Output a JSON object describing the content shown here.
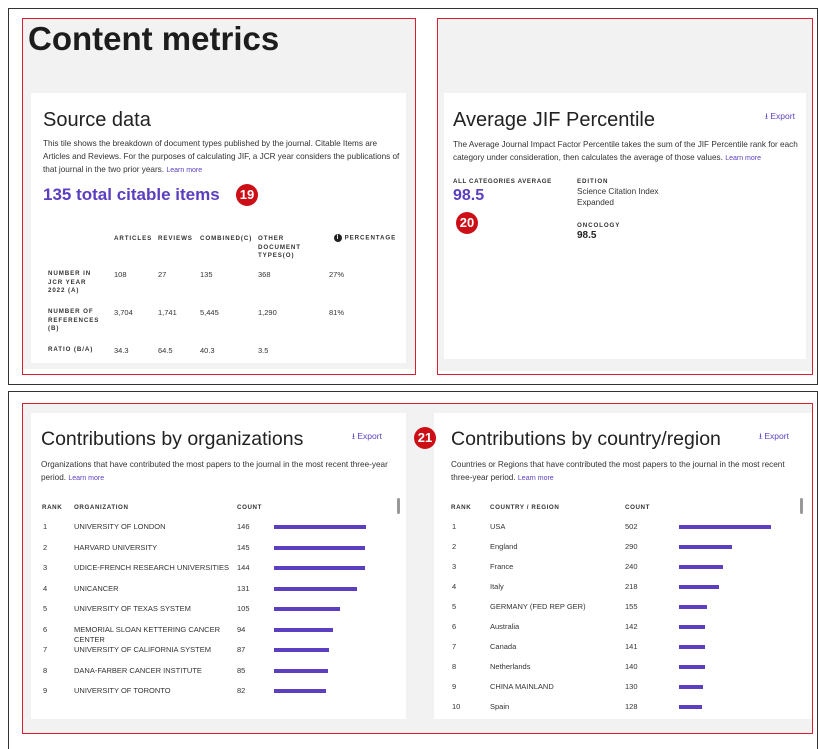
{
  "content_metrics": {
    "title": "Content metrics"
  },
  "source_data": {
    "title": "Source data",
    "description": "This tile shows the breakdown of document types published by the journal. Citable Items are Articles and Reviews. For the purposes of calculating JIF, a JCR year considers the publications of that journal in the two prior years.",
    "learn_more": "Learn more",
    "total": "135 total citable items",
    "headers": [
      "ARTICLES",
      "REVIEWS",
      "COMBINED(C)",
      "OTHER DOCUMENT TYPES(O)",
      "PERCENTAGE"
    ],
    "rows": [
      {
        "label": "NUMBER IN JCR YEAR 2022 (A)",
        "values": [
          "108",
          "27",
          "135",
          "368",
          "27%"
        ]
      },
      {
        "label": "NUMBER OF REFERENCES (B)",
        "values": [
          "3,704",
          "1,741",
          "5,445",
          "1,290",
          "81%"
        ]
      },
      {
        "label": "RATIO (B/A)",
        "values": [
          "34.3",
          "64.5",
          "40.3",
          "3.5",
          ""
        ]
      }
    ]
  },
  "jif": {
    "title": "Average JIF Percentile",
    "export": "Export",
    "description": "The Average Journal Impact Factor Percentile takes the sum of the JIF Percentile rank for each category under consideration, then calculates the average of those values.",
    "learn_more": "Learn more",
    "avg_label": "ALL CATEGORIES AVERAGE",
    "avg_value": "98.5",
    "edition_label": "EDITION",
    "edition_value": "Science Citation Index Expanded",
    "oncology_label": "ONCOLOGY",
    "oncology_value": "98.5"
  },
  "badges": {
    "b19": "19",
    "b20": "20",
    "b21": "21"
  },
  "orgs": {
    "title": "Contributions by organizations",
    "export": "Export",
    "description": "Organizations that have contributed the most papers to the journal in the most recent three-year period.",
    "learn_more": "Learn more",
    "col_rank": "RANK",
    "col_name": "ORGANIZATION",
    "col_count": "COUNT",
    "rows": [
      {
        "rank": "1",
        "name": "UNIVERSITY OF LONDON",
        "count": 146
      },
      {
        "rank": "2",
        "name": "HARVARD UNIVERSITY",
        "count": 145
      },
      {
        "rank": "3",
        "name": "UDICE-FRENCH RESEARCH UNIVERSITIES",
        "count": 144
      },
      {
        "rank": "4",
        "name": "UNICANCER",
        "count": 131
      },
      {
        "rank": "5",
        "name": "UNIVERSITY OF TEXAS SYSTEM",
        "count": 105
      },
      {
        "rank": "6",
        "name": "MEMORIAL SLOAN KETTERING CANCER CENTER",
        "count": 94
      },
      {
        "rank": "7",
        "name": "UNIVERSITY OF CALIFORNIA SYSTEM",
        "count": 87
      },
      {
        "rank": "8",
        "name": "DANA-FARBER CANCER INSTITUTE",
        "count": 85
      },
      {
        "rank": "9",
        "name": "UNIVERSITY OF TORONTO",
        "count": 82
      }
    ]
  },
  "countries": {
    "title": "Contributions by country/region",
    "export": "Export",
    "description": "Countries or Regions that have contributed the most papers to the journal in the most recent three-year period.",
    "learn_more": "Learn more",
    "col_rank": "RANK",
    "col_name": "COUNTRY / REGION",
    "col_count": "COUNT",
    "rows": [
      {
        "rank": "1",
        "name": "USA",
        "count": 502
      },
      {
        "rank": "2",
        "name": "England",
        "count": 290
      },
      {
        "rank": "3",
        "name": "France",
        "count": 240
      },
      {
        "rank": "4",
        "name": "Italy",
        "count": 218
      },
      {
        "rank": "5",
        "name": "GERMANY (FED REP GER)",
        "count": 155
      },
      {
        "rank": "6",
        "name": "Australia",
        "count": 142
      },
      {
        "rank": "7",
        "name": "Canada",
        "count": 141
      },
      {
        "rank": "8",
        "name": "Netherlands",
        "count": 140
      },
      {
        "rank": "9",
        "name": "CHINA MAINLAND",
        "count": 130
      },
      {
        "rank": "10",
        "name": "Spain",
        "count": 128
      }
    ]
  },
  "colors": {
    "accent": "#5b3fc0",
    "badge": "#cc0e17",
    "highlight_box": "#d42030"
  }
}
